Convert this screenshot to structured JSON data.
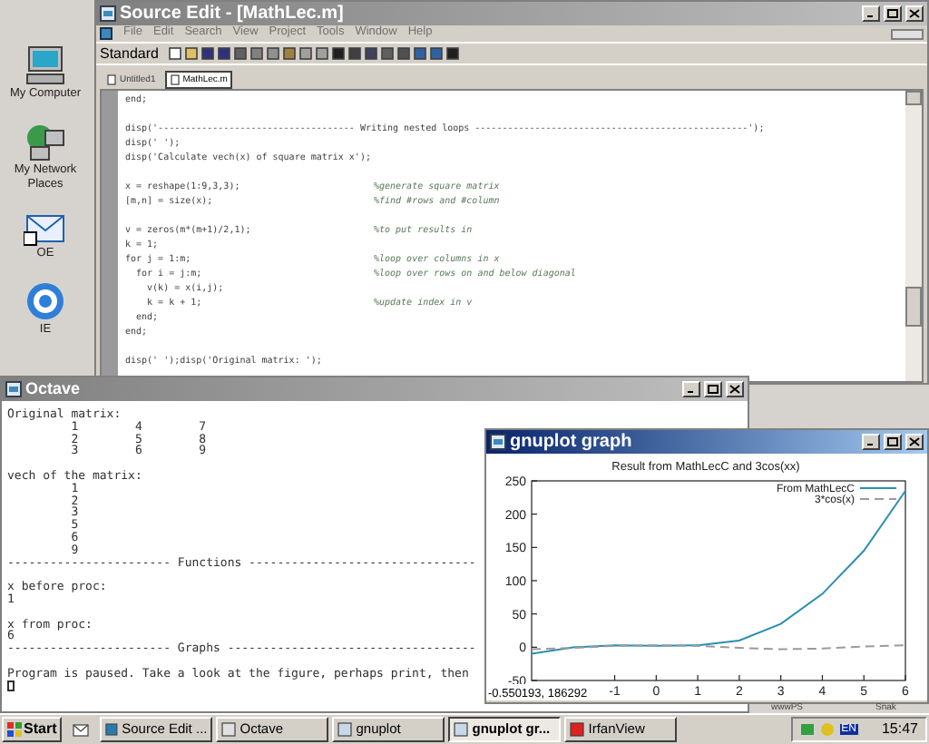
{
  "desktop": {
    "icons": [
      {
        "label": "My Computer",
        "kind": "computer"
      },
      {
        "label": "My Network Places",
        "kind": "network"
      },
      {
        "label": "OE",
        "kind": "mail"
      },
      {
        "label": "IE",
        "kind": "browser"
      }
    ],
    "partial_labels": [
      "wwwPS",
      "Snak"
    ]
  },
  "source_edit": {
    "title": "Source Edit - [MathLec.m]",
    "active": false,
    "menu": [
      "File",
      "Edit",
      "Search",
      "View",
      "Project",
      "Tools",
      "Window",
      "Help"
    ],
    "toolbar_label": "Standard",
    "tabs": [
      {
        "label": "Untitled1",
        "selected": false
      },
      {
        "label": "MathLec.m",
        "selected": true
      }
    ],
    "lines": [
      {
        "kind": "code",
        "code": "end;"
      },
      {
        "kind": "blank"
      },
      {
        "kind": "code",
        "code": "disp('------------------------------------ Writing nested loops --------------------------------------------------');"
      },
      {
        "kind": "code",
        "code": "disp(' ');"
      },
      {
        "kind": "code",
        "code": "disp('Calculate vech(x) of square matrix x');"
      },
      {
        "kind": "blank"
      },
      {
        "kind": "code",
        "code": "x = reshape(1:9,3,3);",
        "comment": "%generate square matrix"
      },
      {
        "kind": "code",
        "code": "[m,n] = size(x);",
        "comment": "%find #rows and #column"
      },
      {
        "kind": "blank"
      },
      {
        "kind": "code",
        "code": "v = zeros(m*(m+1)/2,1);",
        "comment": "%to put results in"
      },
      {
        "kind": "code",
        "code": "k = 1;"
      },
      {
        "kind": "code",
        "code": "for j = 1:m;",
        "comment": "%loop over columns in x"
      },
      {
        "kind": "code",
        "code": "  for i = j:m;",
        "comment": "%loop over rows on and below diagonal"
      },
      {
        "kind": "code",
        "code": "    v(k) = x(i,j);"
      },
      {
        "kind": "code",
        "code": "    k = k + 1;",
        "comment": "%update index in v"
      },
      {
        "kind": "code",
        "code": "  end;"
      },
      {
        "kind": "code",
        "code": "end;"
      },
      {
        "kind": "blank"
      },
      {
        "kind": "code",
        "code": "disp(' ');disp('Original matrix: ');"
      }
    ]
  },
  "octave": {
    "title": "Octave",
    "active": false,
    "cursor_shown": true,
    "lines": [
      {
        "kind": "text",
        "text": "Original matrix:"
      },
      {
        "kind": "text",
        "text": "         1        4        7"
      },
      {
        "kind": "text",
        "text": "         2        5        8"
      },
      {
        "kind": "text",
        "text": "         3        6        9"
      },
      {
        "kind": "blank"
      },
      {
        "kind": "text",
        "text": "vech of the matrix:"
      },
      {
        "kind": "text",
        "text": "         1"
      },
      {
        "kind": "text",
        "text": "         2"
      },
      {
        "kind": "text",
        "text": "         3"
      },
      {
        "kind": "text",
        "text": "         5"
      },
      {
        "kind": "text",
        "text": "         6"
      },
      {
        "kind": "text",
        "text": "         9"
      },
      {
        "kind": "text",
        "text": "----------------------- Functions --------------------------------"
      },
      {
        "kind": "blank"
      },
      {
        "kind": "text",
        "text": "x before proc:"
      },
      {
        "kind": "text",
        "text": "1"
      },
      {
        "kind": "blank"
      },
      {
        "kind": "text",
        "text": "x from proc:"
      },
      {
        "kind": "text",
        "text": "6"
      },
      {
        "kind": "text",
        "text": "----------------------- Graphs -----------------------------------"
      },
      {
        "kind": "blank"
      },
      {
        "kind": "text",
        "text": "Program is paused. Take a look at the figure, perhaps print, then"
      }
    ]
  },
  "gnuplot": {
    "title": "gnuplot graph",
    "active": true,
    "coordinates": "-0.550193, 186292",
    "chart_data": {
      "type": "line",
      "title": "Result from MathLecC and 3cos(xx)",
      "x": [
        -3,
        -2,
        -1,
        0,
        1,
        2,
        3,
        4,
        5,
        6
      ],
      "xlim": [
        -3,
        6
      ],
      "ylim": [
        -50,
        250
      ],
      "xticks": [
        {
          "value": -1,
          "label": "-1"
        },
        {
          "value": 0,
          "label": "0"
        },
        {
          "value": 1,
          "label": "1"
        },
        {
          "value": 2,
          "label": "2"
        },
        {
          "value": 3,
          "label": "3"
        },
        {
          "value": 4,
          "label": "4"
        },
        {
          "value": 5,
          "label": "5"
        },
        {
          "value": 6,
          "label": "6"
        }
      ],
      "yticks": [
        -50,
        0,
        50,
        100,
        150,
        200,
        250
      ],
      "legend": true,
      "series": [
        {
          "name": "From MathLecC",
          "color": "#2a8fb0",
          "line_style": "solid",
          "values": [
            -10,
            0,
            3,
            2,
            3,
            10,
            35,
            80,
            145,
            235
          ]
        },
        {
          "name": "3*cos(x)",
          "color": "#9a9a9a",
          "line_style": "dashed",
          "values": [
            -3,
            -1,
            2,
            3,
            2,
            -1,
            -3,
            -2,
            1,
            3
          ]
        }
      ]
    }
  },
  "taskbar": {
    "start": "Start",
    "buttons": [
      {
        "label": "Source Edit ...",
        "kind": "editor",
        "selected": false
      },
      {
        "label": "Octave",
        "kind": "console",
        "selected": false
      },
      {
        "label": "gnuplot",
        "kind": "plot",
        "selected": false
      },
      {
        "label": "gnuplot gr...",
        "kind": "plot",
        "selected": true
      },
      {
        "label": "IrfanView",
        "kind": "viewer",
        "selected": false
      }
    ],
    "language": "EN",
    "clock": "15:47"
  }
}
